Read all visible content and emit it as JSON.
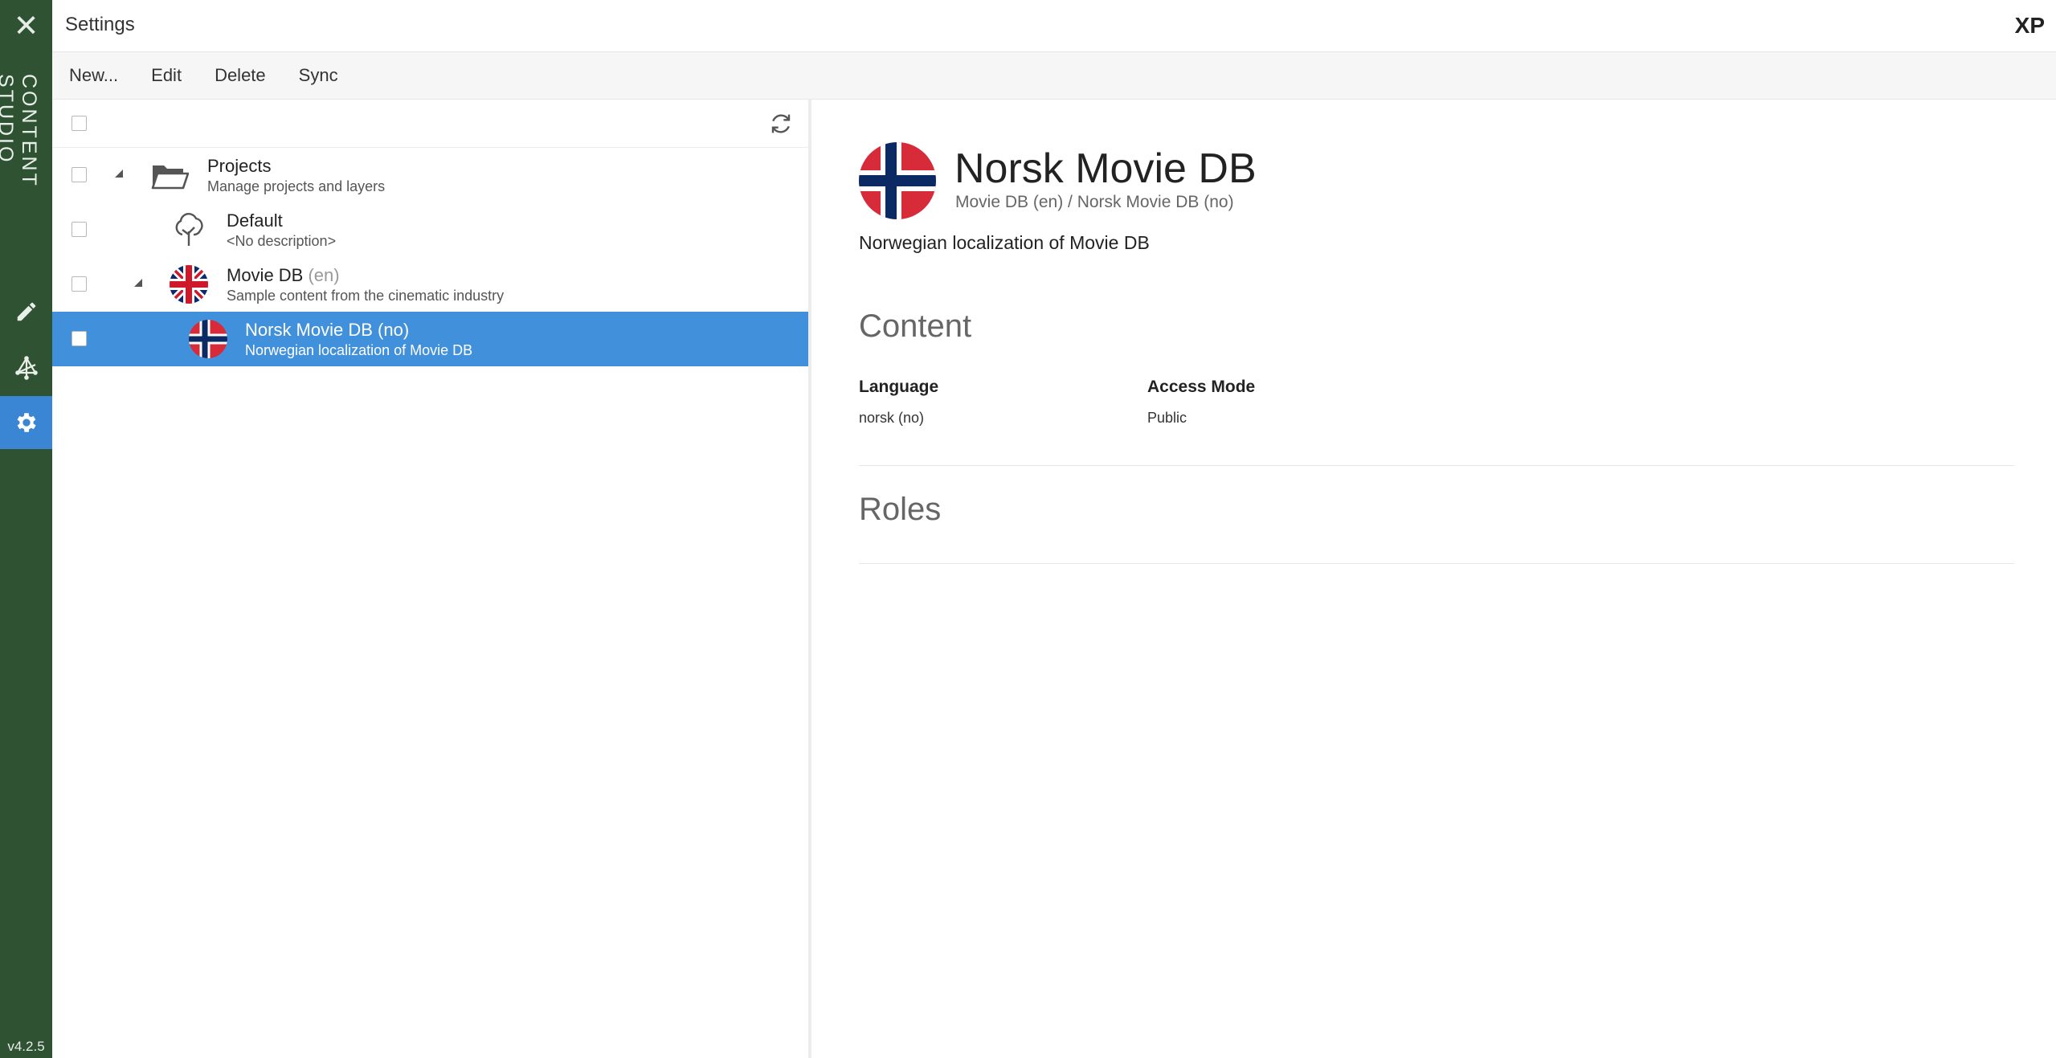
{
  "app": {
    "rail_title": "CONTENT STUDIO",
    "version": "v4.2.5",
    "header_title": "Settings",
    "logo": "XP",
    "rail_icons": [
      "close-icon",
      "pencil-icon",
      "graph-icon",
      "gear-icon"
    ],
    "active_rail": "gear-icon"
  },
  "toolbar": {
    "new_label": "New...",
    "edit_label": "Edit",
    "delete_label": "Delete",
    "sync_label": "Sync"
  },
  "tree": {
    "rows": [
      {
        "name": "Projects",
        "lang": "",
        "desc": "Manage projects and layers",
        "icon": "folder-icon",
        "expanded": true
      },
      {
        "name": "Default",
        "lang": "",
        "desc": "<No description>",
        "icon": "tree-icon"
      },
      {
        "name": "Movie DB",
        "lang": "(en)",
        "desc": "Sample content from the cinematic industry",
        "icon": "uk-flag-icon",
        "expanded": true
      },
      {
        "name": "Norsk Movie DB",
        "lang": "(no)",
        "desc": "Norwegian localization of Movie DB",
        "icon": "norway-flag-icon",
        "selected": true
      }
    ]
  },
  "details": {
    "title": "Norsk Movie DB",
    "subtitle": "Movie DB (en) / Norsk Movie DB (no)",
    "description": "Norwegian localization of Movie DB",
    "content_heading": "Content",
    "language_label": "Language",
    "language_value": "norsk (no)",
    "access_label": "Access Mode",
    "access_value": "Public",
    "roles_heading": "Roles"
  },
  "colors": {
    "rail": "#2f5233",
    "accent": "#3a86d4",
    "selected_row": "#4190dc"
  }
}
